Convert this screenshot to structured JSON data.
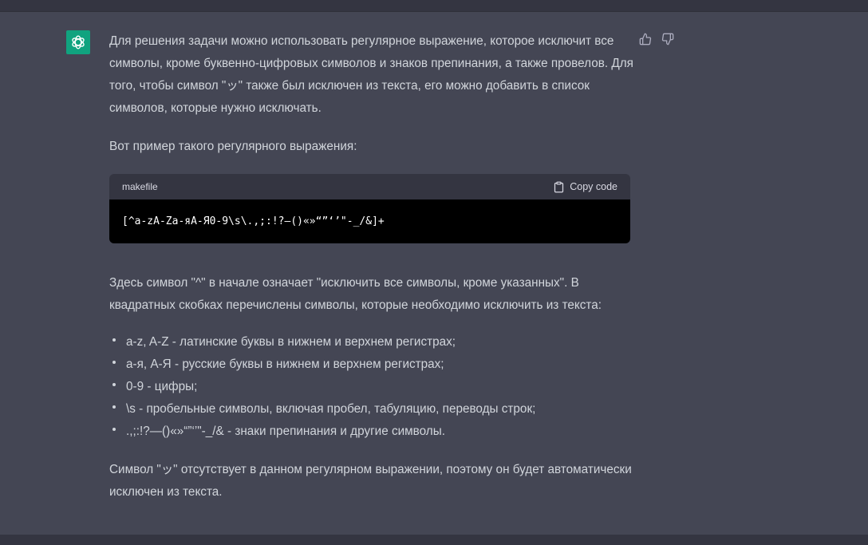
{
  "message": {
    "paragraph1": "Для решения задачи можно использовать регулярное выражение, которое исключит все символы, кроме буквенно-цифровых символов и знаков препинания, а также провелов. Для того, чтобы символ \"ッ\" также был исключен из текста, его можно добавить в список символов, которые нужно исключать.",
    "paragraph2": "Вот пример такого регулярного выражения:",
    "code": {
      "language": "makefile",
      "copy_label": "Copy code",
      "content": "[^a-zA-Zа-яА-Я0-9\\s\\.,;:!?—()«»“”‘’\"-_/&]+"
    },
    "paragraph3": "Здесь символ \"^\" в начале означает \"исключить все символы, кроме указанных\". В квадратных скобках перечислены символы, которые необходимо исключить из текста:",
    "list": [
      "a-z, A-Z - латинские буквы в нижнем и верхнем регистрах;",
      "а-я, А-Я - русские буквы в нижнем и верхнем регистрах;",
      "0-9 - цифры;",
      "\\s - пробельные символы, включая пробел, табуляцию, переводы строк;",
      ".,;:!?—()«»“”‘’\"-_/& - знаки препинания и другие символы."
    ],
    "paragraph4": "Символ \"ッ\" отсутствует в данном регулярном выражении, поэтому он будет автоматически исключен из текста."
  },
  "colors": {
    "background": "#444654",
    "avatar": "#10a37f",
    "code_header": "#343541",
    "code_body": "#000000"
  },
  "icons": {
    "avatar": "openai-logo-icon",
    "copy": "clipboard-icon",
    "like": "thumbs-up-icon",
    "dislike": "thumbs-down-icon"
  }
}
